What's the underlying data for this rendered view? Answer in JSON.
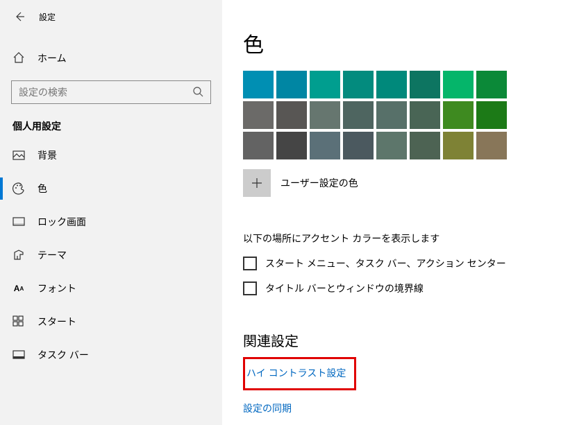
{
  "header": {
    "title": "設定"
  },
  "home_label": "ホーム",
  "search_placeholder": "設定の検索",
  "section_title": "個人用設定",
  "nav": [
    {
      "label": "背景"
    },
    {
      "label": "色"
    },
    {
      "label": "ロック画面"
    },
    {
      "label": "テーマ"
    },
    {
      "label": "フォント"
    },
    {
      "label": "スタート"
    },
    {
      "label": "タスク バー"
    }
  ],
  "page_title": "色",
  "swatches": {
    "row0": [
      "#008fb3",
      "#0086a3",
      "#009e8f",
      "#038b7e",
      "#00897b",
      "#0d7561",
      "#05b56a",
      "#0b8938"
    ],
    "row1": [
      "#6b6a68",
      "#585654",
      "#66766f",
      "#4e6560",
      "#577069",
      "#496555",
      "#3e8a20",
      "#1c7a17"
    ],
    "row2": [
      "#636363",
      "#454545",
      "#5b7078",
      "#4b595f",
      "#5d766b",
      "#4d6353",
      "#7e8235",
      "#887659"
    ]
  },
  "custom_color_label": "ユーザー設定の色",
  "accent_text": "以下の場所にアクセント カラーを表示します",
  "checkbox1_label": "スタート メニュー、タスク バー、アクション センター",
  "checkbox2_label": "タイトル バーとウィンドウの境界線",
  "related_title": "関連設定",
  "link1": "ハイ コントラスト設定",
  "link2": "設定の同期"
}
